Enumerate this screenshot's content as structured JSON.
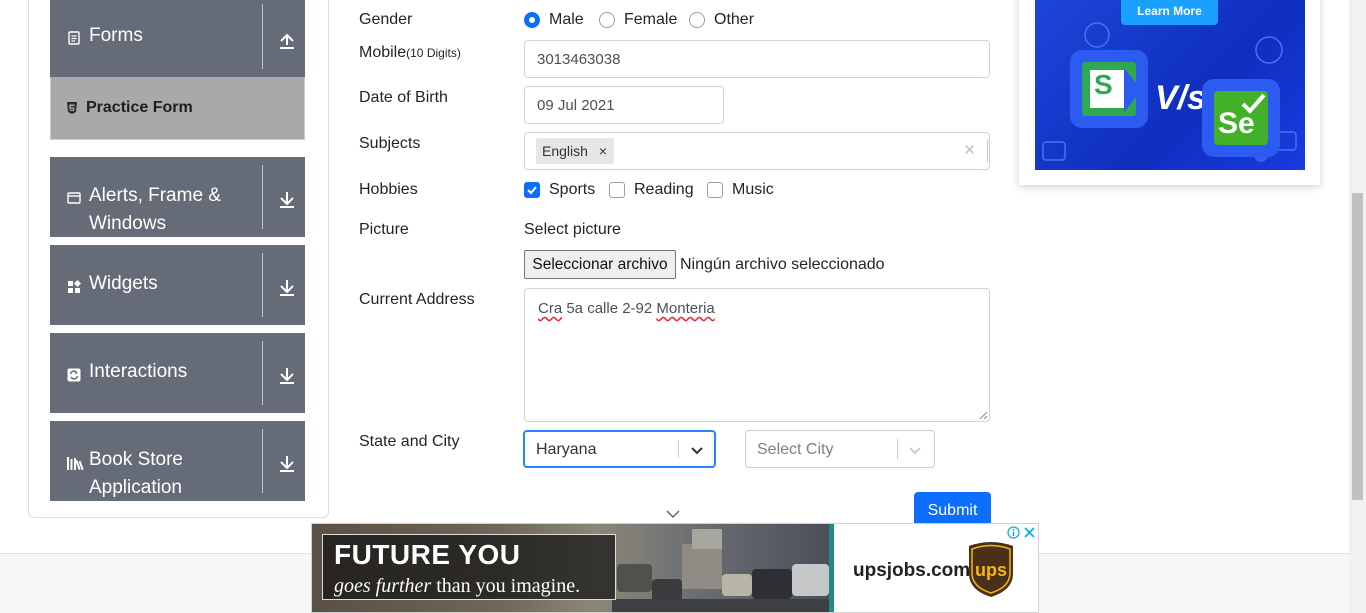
{
  "sidebar": {
    "groups": [
      {
        "label": "Forms",
        "icon": "document-icon",
        "expanded": true
      },
      {
        "label": "Alerts, Frame & Windows",
        "icon": "window-icon",
        "expanded": false
      },
      {
        "label": "Widgets",
        "icon": "widgets-icon",
        "expanded": false
      },
      {
        "label": "Interactions",
        "icon": "interactions-icon",
        "expanded": false
      },
      {
        "label": "Book Store Application",
        "icon": "books-icon",
        "expanded": false
      }
    ],
    "active_item": {
      "label": "Practice Form",
      "icon": "html5-icon"
    }
  },
  "form": {
    "gender": {
      "label": "Gender",
      "options": [
        "Male",
        "Female",
        "Other"
      ],
      "selected": "Male"
    },
    "mobile": {
      "label": "Mobile",
      "hint": "(10 Digits)",
      "value": "3013463038"
    },
    "dob": {
      "label": "Date of Birth",
      "value": "09 Jul 2021"
    },
    "subjects": {
      "label": "Subjects",
      "chips": [
        "English"
      ],
      "clear_symbol": "×",
      "remove_symbol": "×"
    },
    "hobbies": {
      "label": "Hobbies",
      "options": [
        "Sports",
        "Reading",
        "Music"
      ],
      "checked": [
        "Sports"
      ]
    },
    "picture": {
      "label": "Picture",
      "prompt": "Select picture",
      "button": "Seleccionar archivo",
      "status": "Ningún archivo seleccionado"
    },
    "address": {
      "label": "Current Address",
      "value_parts": [
        "Cra",
        " 5a calle 2-92 ",
        "Monteria"
      ]
    },
    "state_city": {
      "label": "State and City",
      "state_value": "Haryana",
      "city_placeholder": "Select City"
    },
    "submit_label": "Submit"
  },
  "ad_top": {
    "button": "Learn More",
    "vs": "V/s",
    "logo_left": "S",
    "logo_right": "Se"
  },
  "ad_bottom": {
    "headline": "FUTURE YOU",
    "subline_italic": "goes further",
    "subline_rest": " than you imagine.",
    "site": "upsjobs.com",
    "logo_text": "ups",
    "colors": {
      "teal": "#1f8a8a",
      "ups_brown": "#4a2f1b",
      "ups_gold": "#f6b70e"
    }
  },
  "colors": {
    "accent": "#0d6efd",
    "sidebar_group": "#656c78",
    "sidebar_active": "#a9a9a9"
  }
}
